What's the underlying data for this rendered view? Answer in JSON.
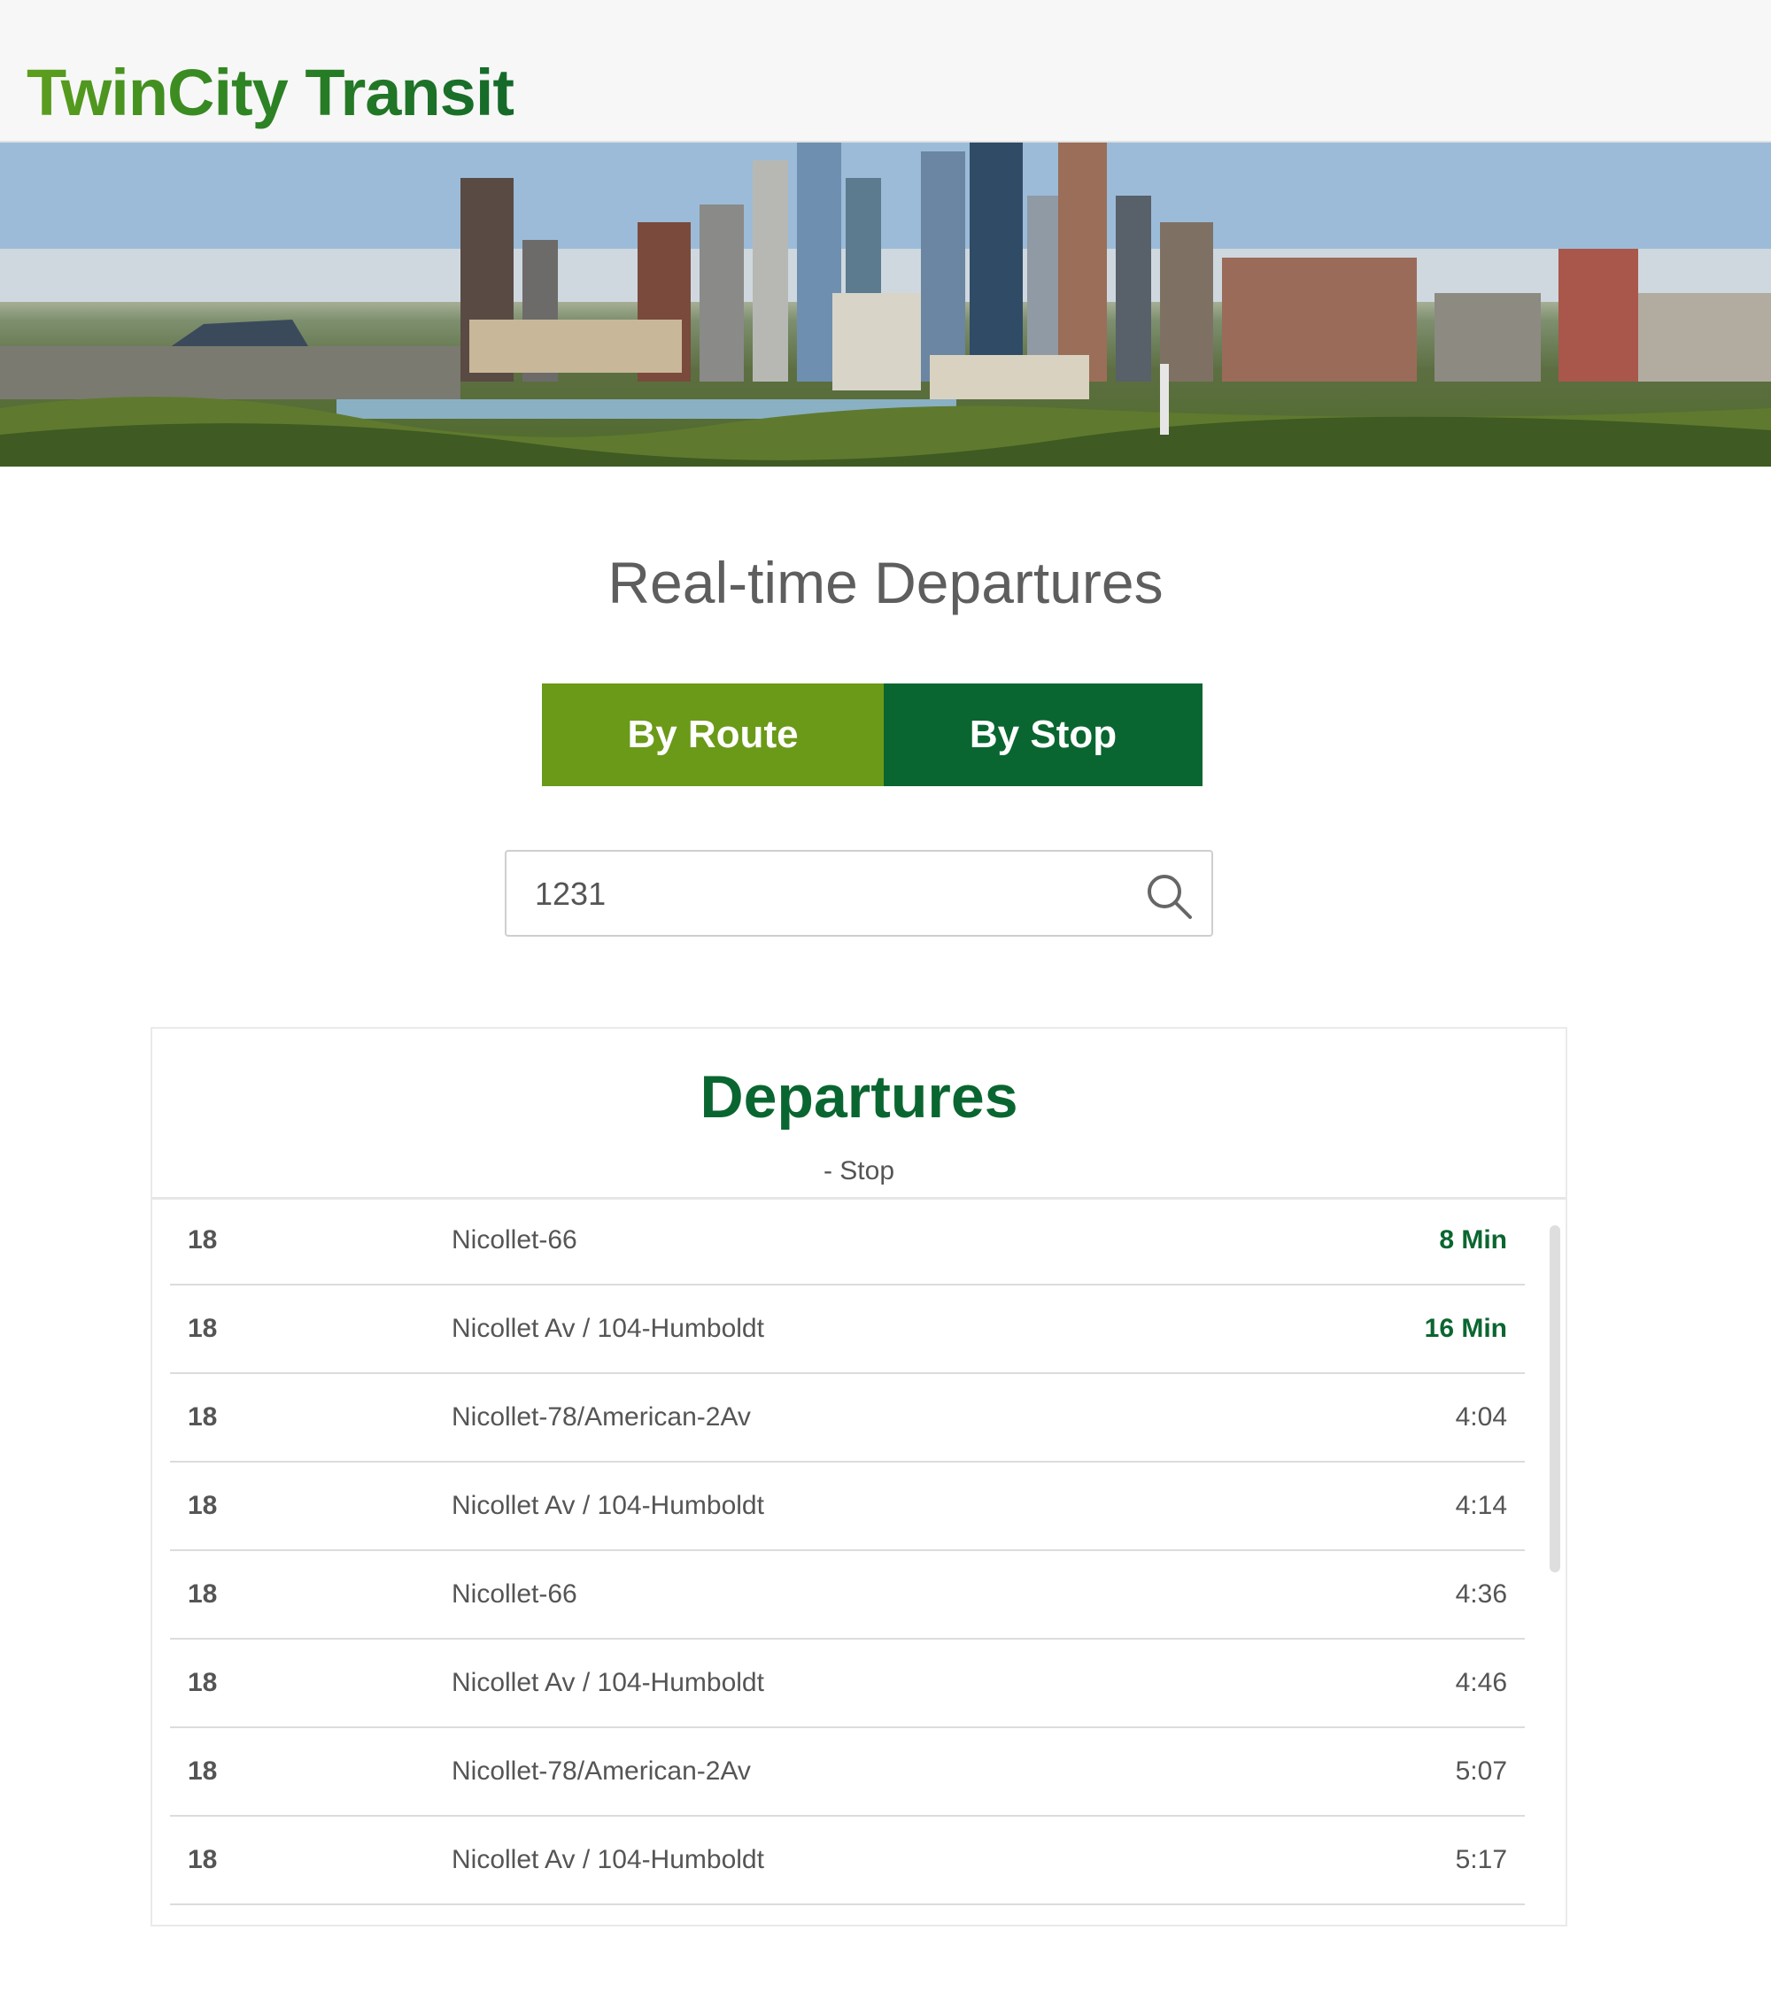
{
  "header": {
    "brand": "TwinCity Transit"
  },
  "page": {
    "title": "Real-time Departures"
  },
  "tabs": [
    {
      "label": "By Route"
    },
    {
      "label": "By Stop"
    }
  ],
  "search": {
    "value": "1231",
    "icon": "search-icon"
  },
  "departures": {
    "title": "Departures",
    "subtitle": "- Stop",
    "rows": [
      {
        "route": "18",
        "destination": "Nicollet-66",
        "time": "8 Min",
        "live": true
      },
      {
        "route": "18",
        "destination": "Nicollet Av / 104-Humboldt",
        "time": "16 Min",
        "live": true
      },
      {
        "route": "18",
        "destination": "Nicollet-78/American-2Av",
        "time": "4:04",
        "live": false
      },
      {
        "route": "18",
        "destination": "Nicollet Av / 104-Humboldt",
        "time": "4:14",
        "live": false
      },
      {
        "route": "18",
        "destination": "Nicollet-66",
        "time": "4:36",
        "live": false
      },
      {
        "route": "18",
        "destination": "Nicollet Av / 104-Humboldt",
        "time": "4:46",
        "live": false
      },
      {
        "route": "18",
        "destination": "Nicollet-78/American-2Av",
        "time": "5:07",
        "live": false
      },
      {
        "route": "18",
        "destination": "Nicollet Av / 104-Humboldt",
        "time": "5:17",
        "live": false
      }
    ]
  },
  "colors": {
    "brand_green_light": "#5e9f1d",
    "brand_green_dark": "#14692a",
    "route_tab": "#6a9a18",
    "stop_tab": "#0a6630",
    "live_time": "#0a6630"
  }
}
